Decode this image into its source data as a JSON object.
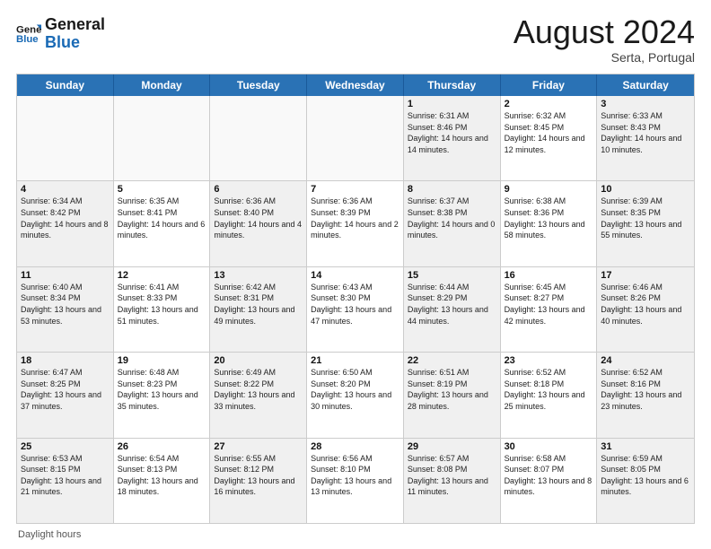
{
  "header": {
    "logo_general": "General",
    "logo_blue": "Blue",
    "month_title": "August 2024",
    "location": "Serta, Portugal"
  },
  "calendar": {
    "days_of_week": [
      "Sunday",
      "Monday",
      "Tuesday",
      "Wednesday",
      "Thursday",
      "Friday",
      "Saturday"
    ],
    "rows": [
      [
        {
          "day": "",
          "sunrise": "",
          "sunset": "",
          "daylight": "",
          "empty": true
        },
        {
          "day": "",
          "sunrise": "",
          "sunset": "",
          "daylight": "",
          "empty": true
        },
        {
          "day": "",
          "sunrise": "",
          "sunset": "",
          "daylight": "",
          "empty": true
        },
        {
          "day": "",
          "sunrise": "",
          "sunset": "",
          "daylight": "",
          "empty": true
        },
        {
          "day": "1",
          "sunrise": "Sunrise: 6:31 AM",
          "sunset": "Sunset: 8:46 PM",
          "daylight": "Daylight: 14 hours and 14 minutes.",
          "empty": false
        },
        {
          "day": "2",
          "sunrise": "Sunrise: 6:32 AM",
          "sunset": "Sunset: 8:45 PM",
          "daylight": "Daylight: 14 hours and 12 minutes.",
          "empty": false
        },
        {
          "day": "3",
          "sunrise": "Sunrise: 6:33 AM",
          "sunset": "Sunset: 8:43 PM",
          "daylight": "Daylight: 14 hours and 10 minutes.",
          "empty": false
        }
      ],
      [
        {
          "day": "4",
          "sunrise": "Sunrise: 6:34 AM",
          "sunset": "Sunset: 8:42 PM",
          "daylight": "Daylight: 14 hours and 8 minutes.",
          "empty": false
        },
        {
          "day": "5",
          "sunrise": "Sunrise: 6:35 AM",
          "sunset": "Sunset: 8:41 PM",
          "daylight": "Daylight: 14 hours and 6 minutes.",
          "empty": false
        },
        {
          "day": "6",
          "sunrise": "Sunrise: 6:36 AM",
          "sunset": "Sunset: 8:40 PM",
          "daylight": "Daylight: 14 hours and 4 minutes.",
          "empty": false
        },
        {
          "day": "7",
          "sunrise": "Sunrise: 6:36 AM",
          "sunset": "Sunset: 8:39 PM",
          "daylight": "Daylight: 14 hours and 2 minutes.",
          "empty": false
        },
        {
          "day": "8",
          "sunrise": "Sunrise: 6:37 AM",
          "sunset": "Sunset: 8:38 PM",
          "daylight": "Daylight: 14 hours and 0 minutes.",
          "empty": false
        },
        {
          "day": "9",
          "sunrise": "Sunrise: 6:38 AM",
          "sunset": "Sunset: 8:36 PM",
          "daylight": "Daylight: 13 hours and 58 minutes.",
          "empty": false
        },
        {
          "day": "10",
          "sunrise": "Sunrise: 6:39 AM",
          "sunset": "Sunset: 8:35 PM",
          "daylight": "Daylight: 13 hours and 55 minutes.",
          "empty": false
        }
      ],
      [
        {
          "day": "11",
          "sunrise": "Sunrise: 6:40 AM",
          "sunset": "Sunset: 8:34 PM",
          "daylight": "Daylight: 13 hours and 53 minutes.",
          "empty": false
        },
        {
          "day": "12",
          "sunrise": "Sunrise: 6:41 AM",
          "sunset": "Sunset: 8:33 PM",
          "daylight": "Daylight: 13 hours and 51 minutes.",
          "empty": false
        },
        {
          "day": "13",
          "sunrise": "Sunrise: 6:42 AM",
          "sunset": "Sunset: 8:31 PM",
          "daylight": "Daylight: 13 hours and 49 minutes.",
          "empty": false
        },
        {
          "day": "14",
          "sunrise": "Sunrise: 6:43 AM",
          "sunset": "Sunset: 8:30 PM",
          "daylight": "Daylight: 13 hours and 47 minutes.",
          "empty": false
        },
        {
          "day": "15",
          "sunrise": "Sunrise: 6:44 AM",
          "sunset": "Sunset: 8:29 PM",
          "daylight": "Daylight: 13 hours and 44 minutes.",
          "empty": false
        },
        {
          "day": "16",
          "sunrise": "Sunrise: 6:45 AM",
          "sunset": "Sunset: 8:27 PM",
          "daylight": "Daylight: 13 hours and 42 minutes.",
          "empty": false
        },
        {
          "day": "17",
          "sunrise": "Sunrise: 6:46 AM",
          "sunset": "Sunset: 8:26 PM",
          "daylight": "Daylight: 13 hours and 40 minutes.",
          "empty": false
        }
      ],
      [
        {
          "day": "18",
          "sunrise": "Sunrise: 6:47 AM",
          "sunset": "Sunset: 8:25 PM",
          "daylight": "Daylight: 13 hours and 37 minutes.",
          "empty": false
        },
        {
          "day": "19",
          "sunrise": "Sunrise: 6:48 AM",
          "sunset": "Sunset: 8:23 PM",
          "daylight": "Daylight: 13 hours and 35 minutes.",
          "empty": false
        },
        {
          "day": "20",
          "sunrise": "Sunrise: 6:49 AM",
          "sunset": "Sunset: 8:22 PM",
          "daylight": "Daylight: 13 hours and 33 minutes.",
          "empty": false
        },
        {
          "day": "21",
          "sunrise": "Sunrise: 6:50 AM",
          "sunset": "Sunset: 8:20 PM",
          "daylight": "Daylight: 13 hours and 30 minutes.",
          "empty": false
        },
        {
          "day": "22",
          "sunrise": "Sunrise: 6:51 AM",
          "sunset": "Sunset: 8:19 PM",
          "daylight": "Daylight: 13 hours and 28 minutes.",
          "empty": false
        },
        {
          "day": "23",
          "sunrise": "Sunrise: 6:52 AM",
          "sunset": "Sunset: 8:18 PM",
          "daylight": "Daylight: 13 hours and 25 minutes.",
          "empty": false
        },
        {
          "day": "24",
          "sunrise": "Sunrise: 6:52 AM",
          "sunset": "Sunset: 8:16 PM",
          "daylight": "Daylight: 13 hours and 23 minutes.",
          "empty": false
        }
      ],
      [
        {
          "day": "25",
          "sunrise": "Sunrise: 6:53 AM",
          "sunset": "Sunset: 8:15 PM",
          "daylight": "Daylight: 13 hours and 21 minutes.",
          "empty": false
        },
        {
          "day": "26",
          "sunrise": "Sunrise: 6:54 AM",
          "sunset": "Sunset: 8:13 PM",
          "daylight": "Daylight: 13 hours and 18 minutes.",
          "empty": false
        },
        {
          "day": "27",
          "sunrise": "Sunrise: 6:55 AM",
          "sunset": "Sunset: 8:12 PM",
          "daylight": "Daylight: 13 hours and 16 minutes.",
          "empty": false
        },
        {
          "day": "28",
          "sunrise": "Sunrise: 6:56 AM",
          "sunset": "Sunset: 8:10 PM",
          "daylight": "Daylight: 13 hours and 13 minutes.",
          "empty": false
        },
        {
          "day": "29",
          "sunrise": "Sunrise: 6:57 AM",
          "sunset": "Sunset: 8:08 PM",
          "daylight": "Daylight: 13 hours and 11 minutes.",
          "empty": false
        },
        {
          "day": "30",
          "sunrise": "Sunrise: 6:58 AM",
          "sunset": "Sunset: 8:07 PM",
          "daylight": "Daylight: 13 hours and 8 minutes.",
          "empty": false
        },
        {
          "day": "31",
          "sunrise": "Sunrise: 6:59 AM",
          "sunset": "Sunset: 8:05 PM",
          "daylight": "Daylight: 13 hours and 6 minutes.",
          "empty": false
        }
      ]
    ]
  },
  "footer": {
    "note": "Daylight hours"
  }
}
